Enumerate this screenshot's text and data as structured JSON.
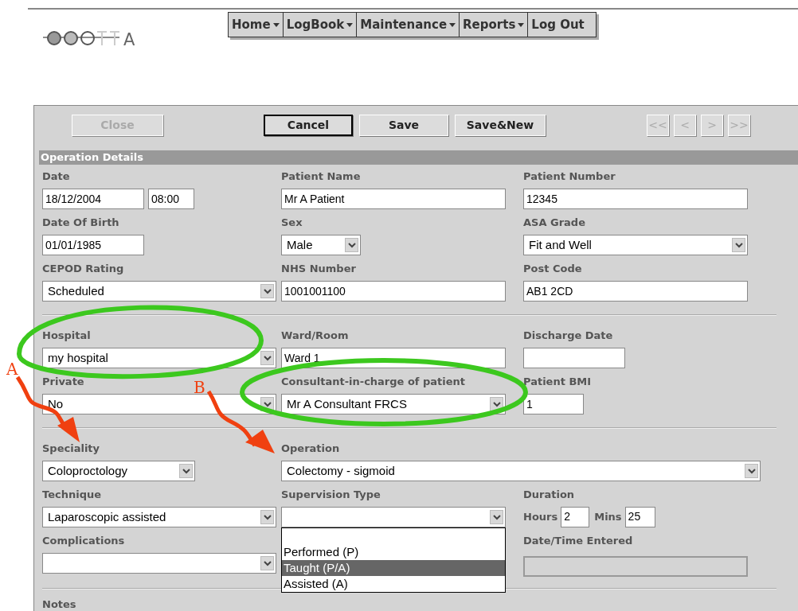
{
  "logo": {
    "letter": "A"
  },
  "menu": [
    {
      "label": "Home",
      "has_dropdown": true
    },
    {
      "label": "LogBook",
      "has_dropdown": true
    },
    {
      "label": "Maintenance",
      "has_dropdown": true
    },
    {
      "label": "Reports",
      "has_dropdown": true
    },
    {
      "label": "Log Out",
      "has_dropdown": false
    }
  ],
  "toolbar": {
    "buttons": [
      {
        "label": "Close",
        "disabled": true,
        "default": false
      },
      {
        "label": "Cancel",
        "disabled": false,
        "default": true
      },
      {
        "label": "Save",
        "disabled": false,
        "default": false
      },
      {
        "label": "Save&New",
        "disabled": false,
        "default": false
      }
    ],
    "nav_buttons": [
      {
        "label": "<<",
        "disabled": true
      },
      {
        "label": "<",
        "disabled": true
      },
      {
        "label": ">",
        "disabled": true
      },
      {
        "label": ">>",
        "disabled": true
      }
    ]
  },
  "section_title": "Operation Details",
  "groups": [
    [
      [
        {
          "kind": "datetime",
          "label": "Date",
          "value": "18/12/2004",
          "time": "08:00"
        },
        {
          "kind": "text",
          "label": "Patient Name",
          "value": "Mr A Patient"
        },
        {
          "kind": "text",
          "label": "Patient Number",
          "value": "12345"
        }
      ],
      [
        {
          "kind": "text",
          "label": "Date Of Birth",
          "value": "01/01/1985"
        },
        {
          "kind": "select",
          "label": "Sex",
          "value": "Male"
        },
        {
          "kind": "select",
          "label": "ASA Grade",
          "value": "Fit and Well"
        }
      ],
      [
        {
          "kind": "select",
          "label": "CEPOD Rating",
          "value": "Scheduled"
        },
        {
          "kind": "text",
          "label": "NHS Number",
          "value": "1001001100"
        },
        {
          "kind": "text",
          "label": "Post Code",
          "value": "AB1 2CD"
        }
      ]
    ],
    [
      [
        {
          "kind": "select",
          "label": "Hospital",
          "value": "my hospital"
        },
        {
          "kind": "text",
          "label": "Ward/Room",
          "value": "Ward 1"
        },
        {
          "kind": "text",
          "label": "Discharge Date"
        }
      ],
      [
        {
          "kind": "select",
          "label": "Private",
          "value": "No"
        },
        {
          "kind": "select",
          "label": "Consultant-in-charge of patient",
          "value": "Mr A Consultant FRCS"
        },
        {
          "kind": "text",
          "label": "Patient BMI",
          "value": "1"
        }
      ]
    ],
    [
      [
        {
          "kind": "select",
          "label": "Speciality",
          "value": "Coloproctology"
        },
        {
          "kind": "select",
          "label": "Operation",
          "value": "Colectomy - sigmoid"
        }
      ],
      [
        {
          "kind": "select",
          "label": "Technique",
          "value": "Laparoscopic assisted"
        },
        {
          "kind": "select",
          "label": "Supervision Type",
          "expanded": true,
          "options": [
            {
              "label": "Performed (P)",
              "selected": false
            },
            {
              "label": "Taught (P/A)",
              "selected": true
            },
            {
              "label": "Assisted (A)",
              "selected": false
            }
          ]
        },
        {
          "kind": "duration",
          "label": "Duration",
          "hours_label": "Hours",
          "hours": "2",
          "mins_label": "Mins",
          "mins": "25"
        }
      ],
      [
        {
          "kind": "select",
          "label": "Complications"
        },
        {
          "kind": "blank"
        },
        {
          "kind": "readonly",
          "label": "Date/Time Entered"
        }
      ]
    ],
    [
      [
        {
          "kind": "label_only",
          "label": "Notes"
        }
      ]
    ]
  ],
  "annotations": [
    {
      "kind": "arrow",
      "letter": "A"
    },
    {
      "kind": "arrow",
      "letter": "B"
    },
    {
      "kind": "ellipse"
    },
    {
      "kind": "ellipse"
    }
  ]
}
